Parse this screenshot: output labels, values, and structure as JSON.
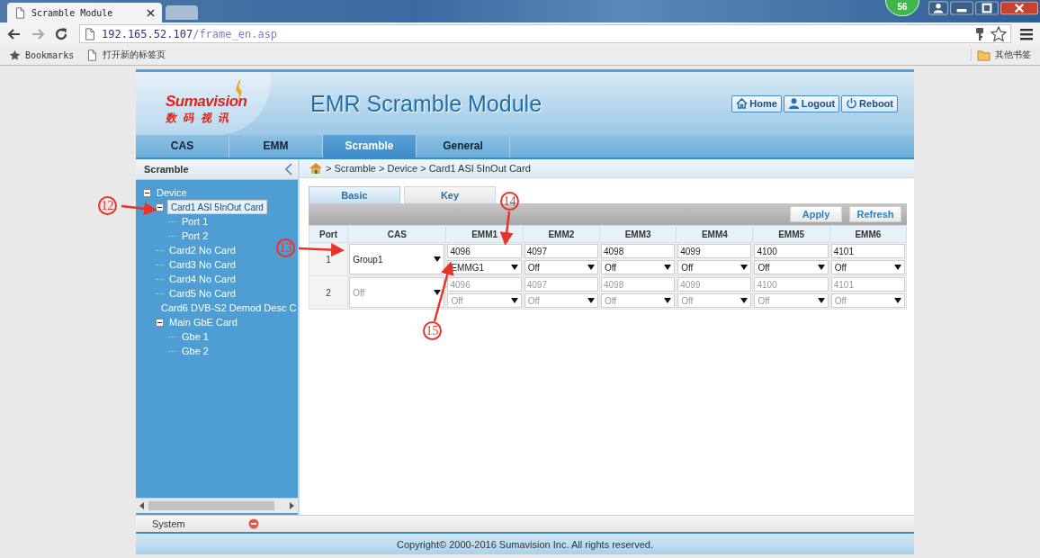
{
  "browser": {
    "tabs": [
      {
        "title": "Scramble Module",
        "selected": true
      },
      {
        "selected": false
      }
    ],
    "url_host": "192.165.52.107",
    "url_path": "/frame_en.asp",
    "badge": "56",
    "bookmarks": [
      {
        "kind": "star",
        "label": "Bookmarks"
      },
      {
        "kind": "page",
        "label": "打开新的标签页"
      }
    ],
    "other_bookmarks": "其他书签"
  },
  "header": {
    "logo": "Sumavision",
    "logo_sub": "数 码 视 讯",
    "title": "EMR Scramble Module",
    "buttons": [
      {
        "kind": "home",
        "label": "Home"
      },
      {
        "kind": "user",
        "label": "Logout"
      },
      {
        "kind": "power",
        "label": "Reboot"
      }
    ]
  },
  "nav": [
    {
      "label": "CAS",
      "selected": false
    },
    {
      "label": "EMM",
      "selected": false
    },
    {
      "label": "Scramble",
      "selected": true
    },
    {
      "label": "General",
      "selected": false
    }
  ],
  "sidebar": {
    "title": "Scramble",
    "tree": [
      {
        "label": "Device",
        "expanded": true,
        "selected": false,
        "children": [
          {
            "label": "Card1 ASI 5InOut Card",
            "expanded": true,
            "selected": true,
            "children": [
              {
                "label": "Port 1",
                "selected": false
              },
              {
                "label": "Port 2",
                "selected": false
              }
            ]
          },
          {
            "label": "Card2 No Card",
            "selected": false
          },
          {
            "label": "Card3 No Card",
            "selected": false
          },
          {
            "label": "Card4 No Card",
            "selected": false
          },
          {
            "label": "Card5 No Card",
            "selected": false
          },
          {
            "label": "Card6 DVB-S2 Demod Desc C",
            "selected": false
          },
          {
            "label": "Main GbE Card",
            "expanded": true,
            "selected": false,
            "children": [
              {
                "label": "Gbe 1",
                "selected": false
              },
              {
                "label": "Gbe 2",
                "selected": false
              }
            ]
          }
        ]
      }
    ]
  },
  "breadcrumb": "> Scramble > Device > Card1 ASI 5InOut Card",
  "subtabs": [
    {
      "label": "Basic",
      "selected": true
    },
    {
      "label": "Key",
      "selected": false
    }
  ],
  "actions": [
    "Apply",
    "Refresh"
  ],
  "table": {
    "columns": [
      "Port",
      "CAS",
      "EMM1",
      "EMM2",
      "EMM3",
      "EMM4",
      "EMM5",
      "EMM6"
    ],
    "rows": [
      {
        "port": "1",
        "cas": "Group1",
        "disabled": false,
        "emm": [
          {
            "pid": "4096",
            "group": "EMMG1"
          },
          {
            "pid": "4097",
            "group": "Off"
          },
          {
            "pid": "4098",
            "group": "Off"
          },
          {
            "pid": "4099",
            "group": "Off"
          },
          {
            "pid": "4100",
            "group": "Off"
          },
          {
            "pid": "4101",
            "group": "Off"
          }
        ]
      },
      {
        "port": "2",
        "cas": "Off",
        "disabled": true,
        "emm": [
          {
            "pid": "4096",
            "group": "Off"
          },
          {
            "pid": "4097",
            "group": "Off"
          },
          {
            "pid": "4098",
            "group": "Off"
          },
          {
            "pid": "4099",
            "group": "Off"
          },
          {
            "pid": "4100",
            "group": "Off"
          },
          {
            "pid": "4101",
            "group": "Off"
          }
        ]
      }
    ]
  },
  "system": "System",
  "footer": "Copyright© 2000-2016 Sumavision Inc. All rights reserved.",
  "annotations": [
    "12",
    "13",
    "14",
    "15"
  ]
}
